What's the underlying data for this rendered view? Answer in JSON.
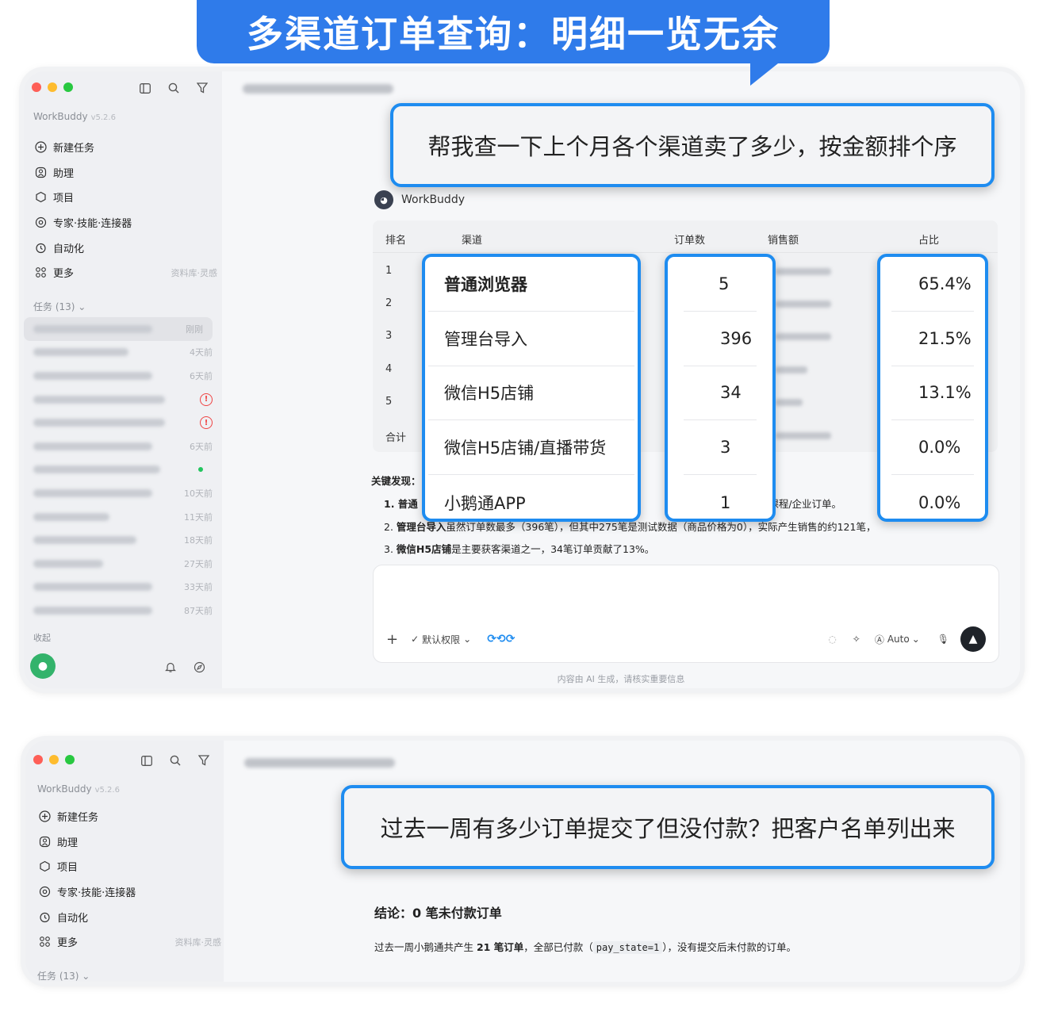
{
  "banner": {
    "title": "多渠道订单查询：明细一览无余"
  },
  "sidebar": {
    "app_name": "WorkBuddy",
    "version": "v5.2.6",
    "items": [
      {
        "label": "新建任务",
        "icon": "plus-circle-icon"
      },
      {
        "label": "助理",
        "icon": "assistant-icon"
      },
      {
        "label": "项目",
        "icon": "project-icon"
      },
      {
        "label": "专家·技能·连接器",
        "icon": "expert-icon"
      },
      {
        "label": "自动化",
        "icon": "automation-icon"
      },
      {
        "label": "更多",
        "icon": "more-grid-icon",
        "extra": "资料库·灵感"
      }
    ],
    "tasks_header": "任务 (13)",
    "tasks": [
      {
        "time": "刚刚"
      },
      {
        "time": "4天前"
      },
      {
        "time": "6天前"
      },
      {
        "time": ""
      },
      {
        "time": ""
      },
      {
        "time": "6天前"
      },
      {
        "time": ""
      },
      {
        "time": "10天前"
      },
      {
        "time": "11天前"
      },
      {
        "time": "18天前"
      },
      {
        "time": "27天前"
      },
      {
        "time": "33天前"
      },
      {
        "time": "87天前"
      }
    ],
    "favorites": "收起"
  },
  "window1": {
    "user_query": "帮我查一下上个月各个渠道卖了多少，按金额排个序",
    "assistant_name": "WorkBuddy",
    "table": {
      "headers": [
        "排名",
        "渠道",
        "订单数",
        "销售额",
        "占比"
      ],
      "ranks": [
        "1",
        "2",
        "3",
        "4",
        "5",
        "合计"
      ],
      "channels": [
        "普通浏览器",
        "管理台导入",
        "微信H5店铺",
        "微信H5店铺/直播带货",
        "小鹅通APP"
      ],
      "orders": [
        "5",
        "396",
        "34",
        "3",
        "1"
      ],
      "shares": [
        "65.4%",
        "21.5%",
        "13.1%",
        "0.0%",
        "0.0%"
      ]
    },
    "findings": {
      "title": "关键发现：",
      "line1_prefix": "1. 普通",
      "line1_suffix": "额课程/企业订单。",
      "line2_bold": "管理台导入",
      "line2_prefix": "2. ",
      "line2_rest": "虽然订单数最多（396笔），但其中275笔是测试数据（商品价格为0），实际产生销售的约121笔，",
      "line3_prefix": "3. ",
      "line3_bold": "微信H5店铺",
      "line3_rest": "是主要获客渠道之一，34笔订单贡献了13%。"
    },
    "input_bar": {
      "permission": "默认权限",
      "mode": "Auto"
    },
    "ai_note": "内容由 AI 生成，请核实重要信息"
  },
  "window2": {
    "user_query": "过去一周有多少订单提交了但没付款？把客户名单列出来",
    "conclusion_title": "结论：0 笔未付款订单",
    "conclusion_prefix": "过去一周小鹅通共产生 ",
    "conclusion_count": "21 笔订单",
    "conclusion_mid": "，全部已付款（",
    "conclusion_code": "pay_state=1",
    "conclusion_end": "），没有提交后未付款的订单。",
    "tasks_header": "任务 (13)"
  },
  "colors": {
    "accent": "#1e8cf0",
    "banner": "#2f7bea"
  }
}
